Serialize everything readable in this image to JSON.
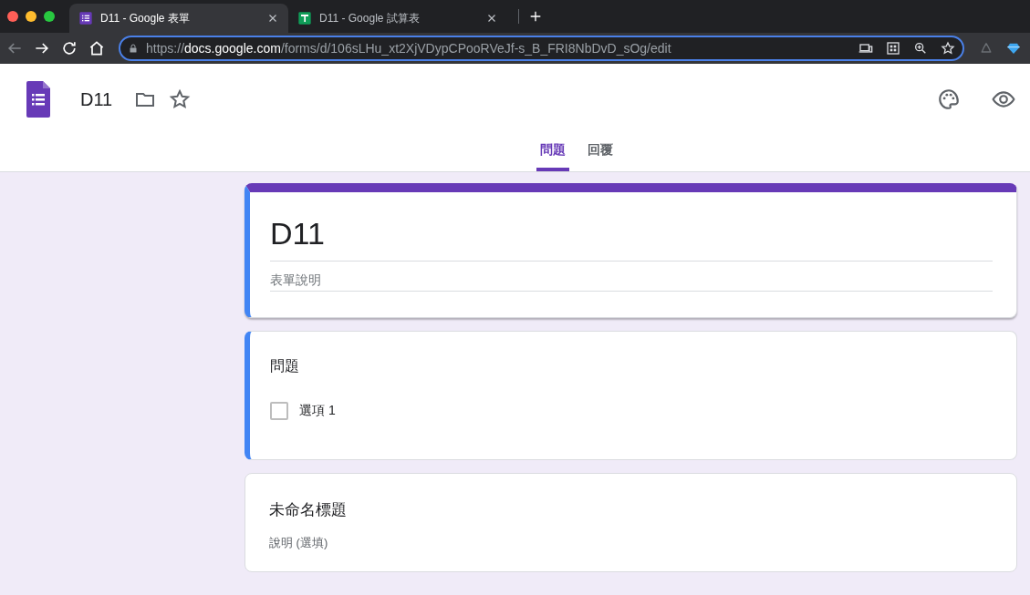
{
  "browser": {
    "tabs": [
      {
        "title": "D11 - Google 表單",
        "kind": "forms",
        "selected": true
      },
      {
        "title": "D11 - Google 試算表",
        "kind": "sheets",
        "selected": false
      }
    ],
    "url": {
      "scheme": "https://",
      "host": "docs.google.com",
      "path": "/forms/d/106sLHu_xt2XjVDypCPooRVeJf-s_B_FRI8NbDvD_sOg/edit"
    }
  },
  "app": {
    "title": "D11",
    "tabs": [
      {
        "label": "問題",
        "selected": true
      },
      {
        "label": "回覆",
        "selected": false
      }
    ]
  },
  "form": {
    "title": "D11",
    "description_placeholder": "表單說明",
    "highlighted": true
  },
  "cards": [
    {
      "kind": "question",
      "title": "問題",
      "highlighted": true,
      "options": [
        {
          "label": "選項 1",
          "checked": false
        }
      ]
    },
    {
      "kind": "section",
      "title": "未命名標題",
      "description": "說明 (選填)",
      "highlighted": false
    }
  ]
}
